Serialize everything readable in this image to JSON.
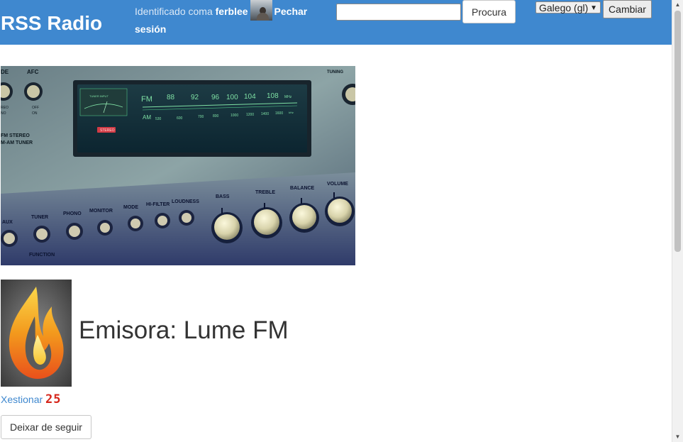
{
  "header": {
    "brand": "RSS Radio",
    "login_prefix": "Identificado coma",
    "username": "ferblee",
    "avatar_icon": "user-avatar",
    "logout_label": "Pechar sesión",
    "search_value": "",
    "search_button": "Procura",
    "language_selected": "Galego (gl)",
    "change_button": "Cambiar",
    "accent_color": "#3f88cf"
  },
  "main": {
    "banner_icon": "radio-receiver-banner",
    "banner_dial": {
      "fm_label": "FM",
      "am_label": "AM",
      "fm_marks": [
        "88",
        "92",
        "96",
        "100",
        "104",
        "108"
      ],
      "fm_unit": "MHz",
      "am_marks": [
        "530",
        "600",
        "700",
        "800",
        "1000",
        "1200",
        "1400",
        "1600"
      ],
      "am_unit": "kHz",
      "tuner_meter": "TUNER INPUT",
      "stereo_lamp": "STEREO"
    },
    "banner_panel_text": {
      "top": [
        "DE",
        "AFC",
        "TUNING"
      ],
      "switches": [
        "REO",
        "OFF",
        "NO",
        "ON"
      ],
      "fm_stereo": "FM STEREO",
      "tuner_name": "M-AM TUNER",
      "knobs": [
        "AUX",
        "TUNER",
        "PHONO",
        "MONITOR",
        "MODE",
        "HI-FILTER",
        "LOUDNESS",
        "BASS",
        "TREBLE",
        "BALANCE",
        "VOLUME"
      ],
      "function_label": "FUNCTION"
    },
    "station_logo_icon": "flame-logo",
    "station_title": "Emisora: Lume FM",
    "manage_link": "Xestionar",
    "manage_count": "25",
    "unfollow_button": "Deixar de seguir"
  }
}
